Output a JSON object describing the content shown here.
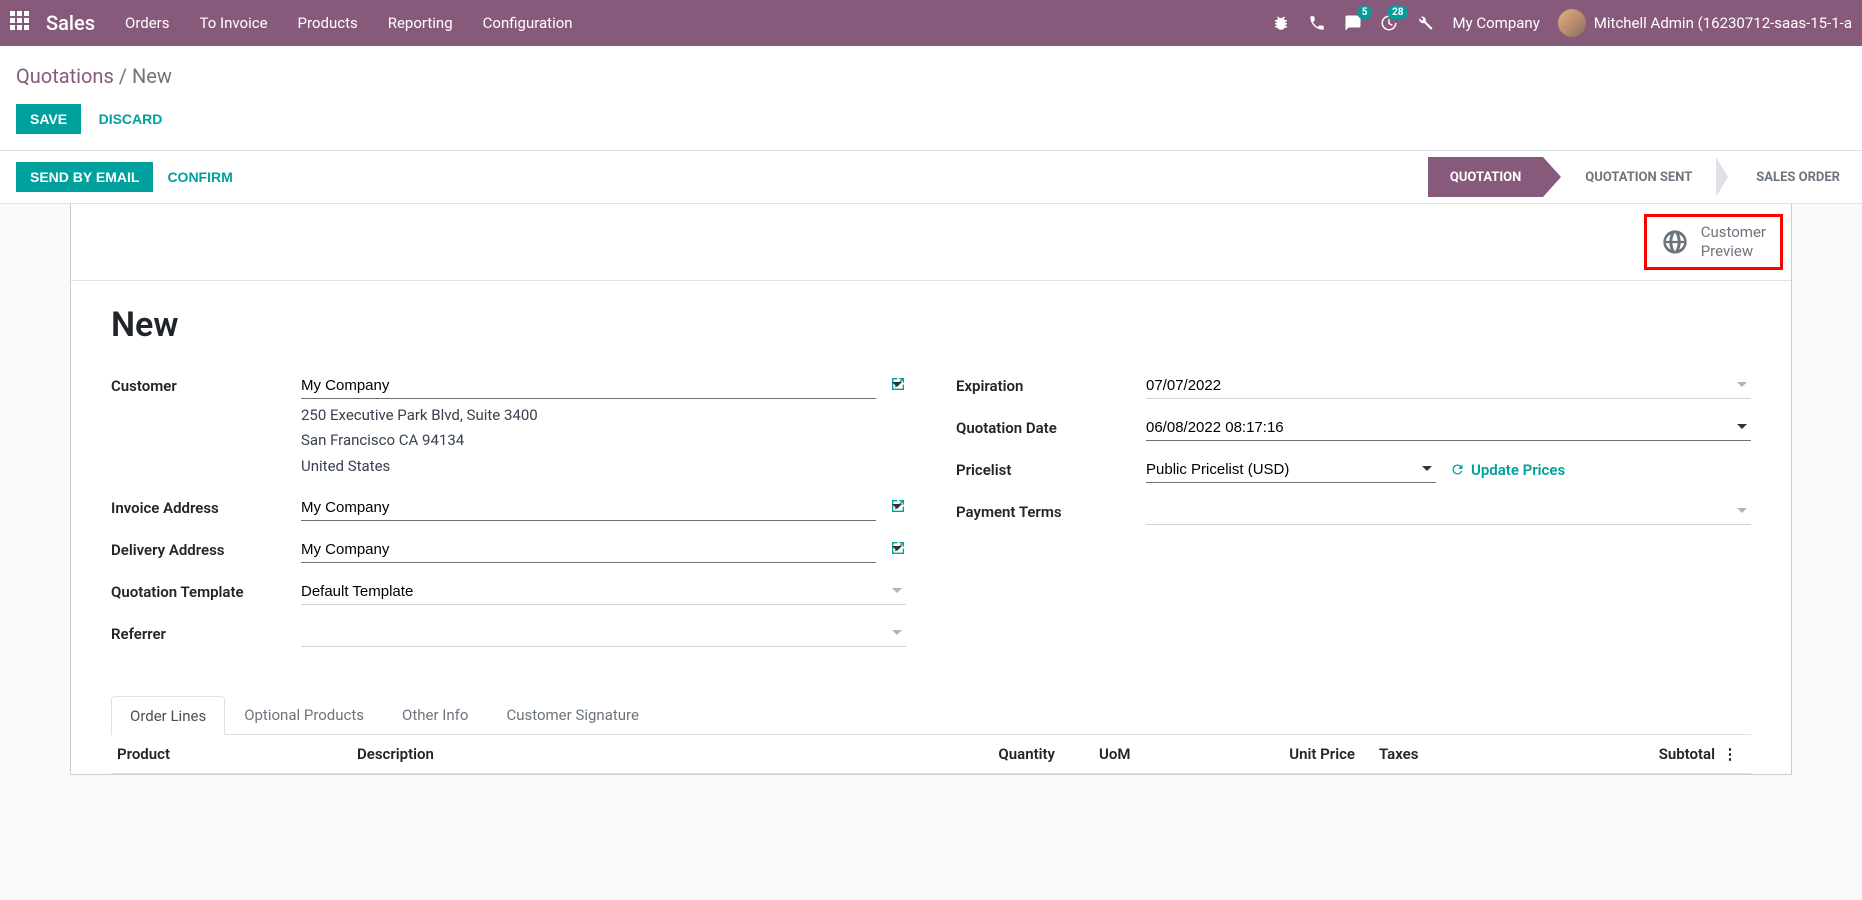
{
  "nav": {
    "brand": "Sales",
    "menu": [
      "Orders",
      "To Invoice",
      "Products",
      "Reporting",
      "Configuration"
    ],
    "msg_badge": "5",
    "act_badge": "28",
    "company": "My Company",
    "user": "Mitchell Admin (16230712-saas-15-1-a"
  },
  "breadcrumb": {
    "root": "Quotations",
    "sep": "/",
    "current": "New"
  },
  "buttons": {
    "save": "SAVE",
    "discard": "DISCARD",
    "email": "SEND BY EMAIL",
    "confirm": "CONFIRM"
  },
  "steps": [
    "QUOTATION",
    "QUOTATION SENT",
    "SALES ORDER"
  ],
  "preview": {
    "line1": "Customer",
    "line2": "Preview"
  },
  "title": "New",
  "labels": {
    "customer": "Customer",
    "invoice_addr": "Invoice Address",
    "delivery_addr": "Delivery Address",
    "quote_tpl": "Quotation Template",
    "referrer": "Referrer",
    "expiration": "Expiration",
    "quote_date": "Quotation Date",
    "pricelist": "Pricelist",
    "payment_terms": "Payment Terms"
  },
  "values": {
    "customer": "My Company",
    "addr1": "250 Executive Park Blvd, Suite 3400",
    "addr2": "San Francisco CA 94134",
    "addr3": "United States",
    "invoice_addr": "My Company",
    "delivery_addr": "My Company",
    "quote_tpl": "Default Template",
    "referrer": "",
    "expiration": "07/07/2022",
    "quote_date": "06/08/2022 08:17:16",
    "pricelist": "Public Pricelist (USD)",
    "payment_terms": ""
  },
  "update_prices": "Update Prices",
  "tabs": [
    "Order Lines",
    "Optional Products",
    "Other Info",
    "Customer Signature"
  ],
  "table_head": {
    "product": "Product",
    "description": "Description",
    "quantity": "Quantity",
    "uom": "UoM",
    "unit_price": "Unit Price",
    "taxes": "Taxes",
    "subtotal": "Subtotal"
  }
}
